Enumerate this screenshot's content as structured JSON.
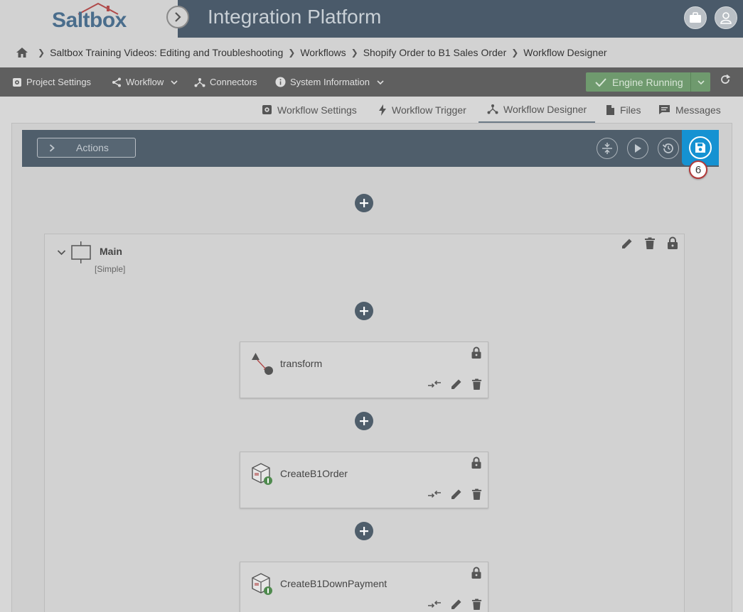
{
  "header": {
    "logo_text": "Saltbox",
    "title": "Integration Platform"
  },
  "breadcrumb": [
    "Saltbox Training Videos: Editing and Troubleshooting",
    "Workflows",
    "Shopify Order to B1 Sales Order",
    "Workflow Designer"
  ],
  "toolbar": {
    "project_settings": "Project Settings",
    "workflow": "Workflow",
    "connectors": "Connectors",
    "system_information": "System Information",
    "engine_status": "Engine Running"
  },
  "subtabs": {
    "workflow_settings": "Workflow Settings",
    "workflow_trigger": "Workflow Trigger",
    "workflow_designer": "Workflow Designer",
    "files": "Files",
    "messages": "Messages",
    "active": "Workflow Designer"
  },
  "actions": {
    "label": "Actions",
    "step_badge": "6"
  },
  "group": {
    "title": "Main",
    "type": "[Simple]"
  },
  "steps": [
    {
      "label": "transform"
    },
    {
      "label": "CreateB1Order"
    },
    {
      "label": "CreateB1DownPayment"
    }
  ],
  "colors": {
    "header": "#4a5a6a",
    "toolbar": "#5f5f5f",
    "engine_green": "#6f9a6e",
    "save_blue": "#1592d2",
    "action_bar": "#4f5e6b"
  }
}
